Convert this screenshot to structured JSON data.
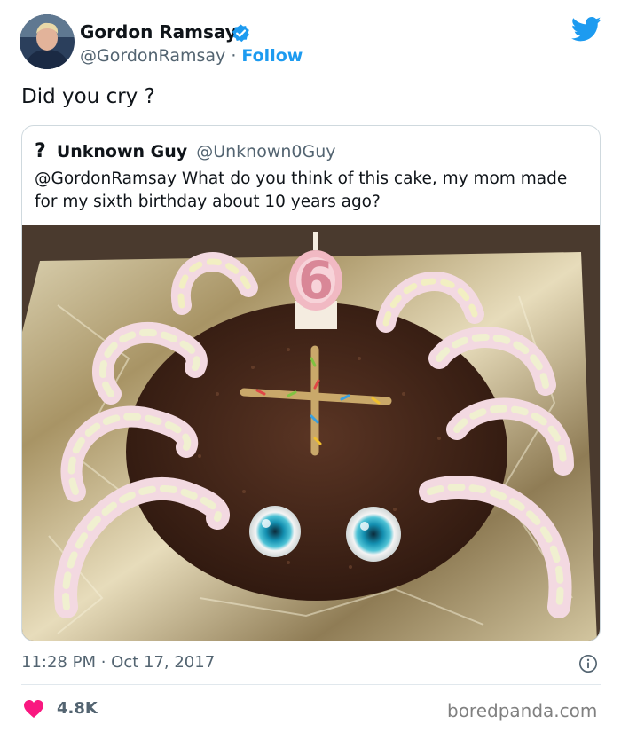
{
  "tweet": {
    "author": {
      "name": "Gordon Ramsay",
      "handle": "@GordonRamsay",
      "separator": "·",
      "follow_label": "Follow"
    },
    "text": "Did you cry ?",
    "quoted": {
      "icon_glyph": "?",
      "name": "Unknown Guy",
      "handle": "@Unknown0Guy",
      "text": "@GordonRamsay What do you think of this cake, my mom made for my sixth birthday about 10 years ago?",
      "candle_number": "6"
    },
    "timestamp": "11:28 PM · Oct 17, 2017",
    "likes": "4.8K"
  },
  "watermark": "boredpanda.com",
  "colors": {
    "link_blue": "#1d9bf0",
    "heart_red": "#f91880",
    "muted": "#536471"
  },
  "icons": {
    "verified": "verified-badge-icon",
    "brand": "twitter-bird-icon",
    "info": "info-icon",
    "like": "heart-icon"
  }
}
